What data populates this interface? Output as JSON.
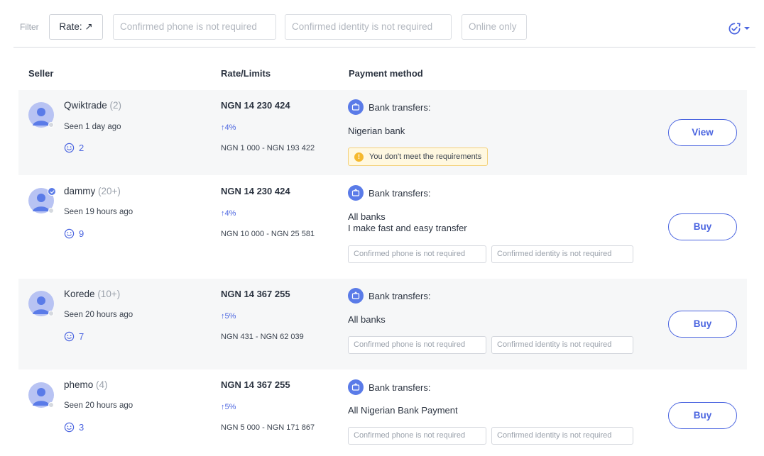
{
  "filter": {
    "label": "Filter",
    "rate_chip": "Rate: ↗",
    "phone_chip": "Confirmed phone is not required",
    "identity_chip": "Confirmed identity is not required",
    "online_chip": "Online only",
    "refresh_icon": "refresh-check-icon",
    "accent": "#4b65e0"
  },
  "columns": {
    "seller": "Seller",
    "rate": "Rate/Limits",
    "payment": "Payment method"
  },
  "rows": [
    {
      "name": "Qwiktrade",
      "count": "(2)",
      "seen": "Seen 1 day ago",
      "rating": "2",
      "price": "NGN 14 230 424",
      "percent": "↑4%",
      "limits": "NGN 1 000 - NGN 193 422",
      "method": "Bank transfers:",
      "desc1": "Nigerian bank",
      "desc2": "",
      "warning": "You don't meet the requirements",
      "action": "View"
    },
    {
      "name": "dammy",
      "count": "(20+)",
      "seen": "Seen 19 hours ago",
      "rating": "9",
      "price": "NGN 14 230 424",
      "percent": "↑4%",
      "limits": "NGN 10 000 - NGN 25 581",
      "method": "Bank transfers:",
      "desc1": "All banks",
      "desc2": "I make fast and easy transfer",
      "tag1": "Confirmed phone is not required",
      "tag2": "Confirmed identity is not required",
      "action": "Buy"
    },
    {
      "name": "Korede",
      "count": "(10+)",
      "seen": "Seen 20 hours ago",
      "rating": "7",
      "price": "NGN 14 367 255",
      "percent": "↑5%",
      "limits": "NGN 431 - NGN 62 039",
      "method": "Bank transfers:",
      "desc1": "All banks",
      "desc2": "",
      "tag1": "Confirmed phone is not required",
      "tag2": "Confirmed identity is not required",
      "action": "Buy"
    },
    {
      "name": "phemo",
      "count": "(4)",
      "seen": "Seen 20 hours ago",
      "rating": "3",
      "price": "NGN 14 367 255",
      "percent": "↑5%",
      "limits": "NGN 5 000 - NGN 171 867",
      "method": "Bank transfers:",
      "desc1": "All Nigerian Bank Payment",
      "desc2": "",
      "tag1": "Confirmed phone is not required",
      "tag2": "Confirmed identity is not required",
      "action": "Buy"
    }
  ]
}
